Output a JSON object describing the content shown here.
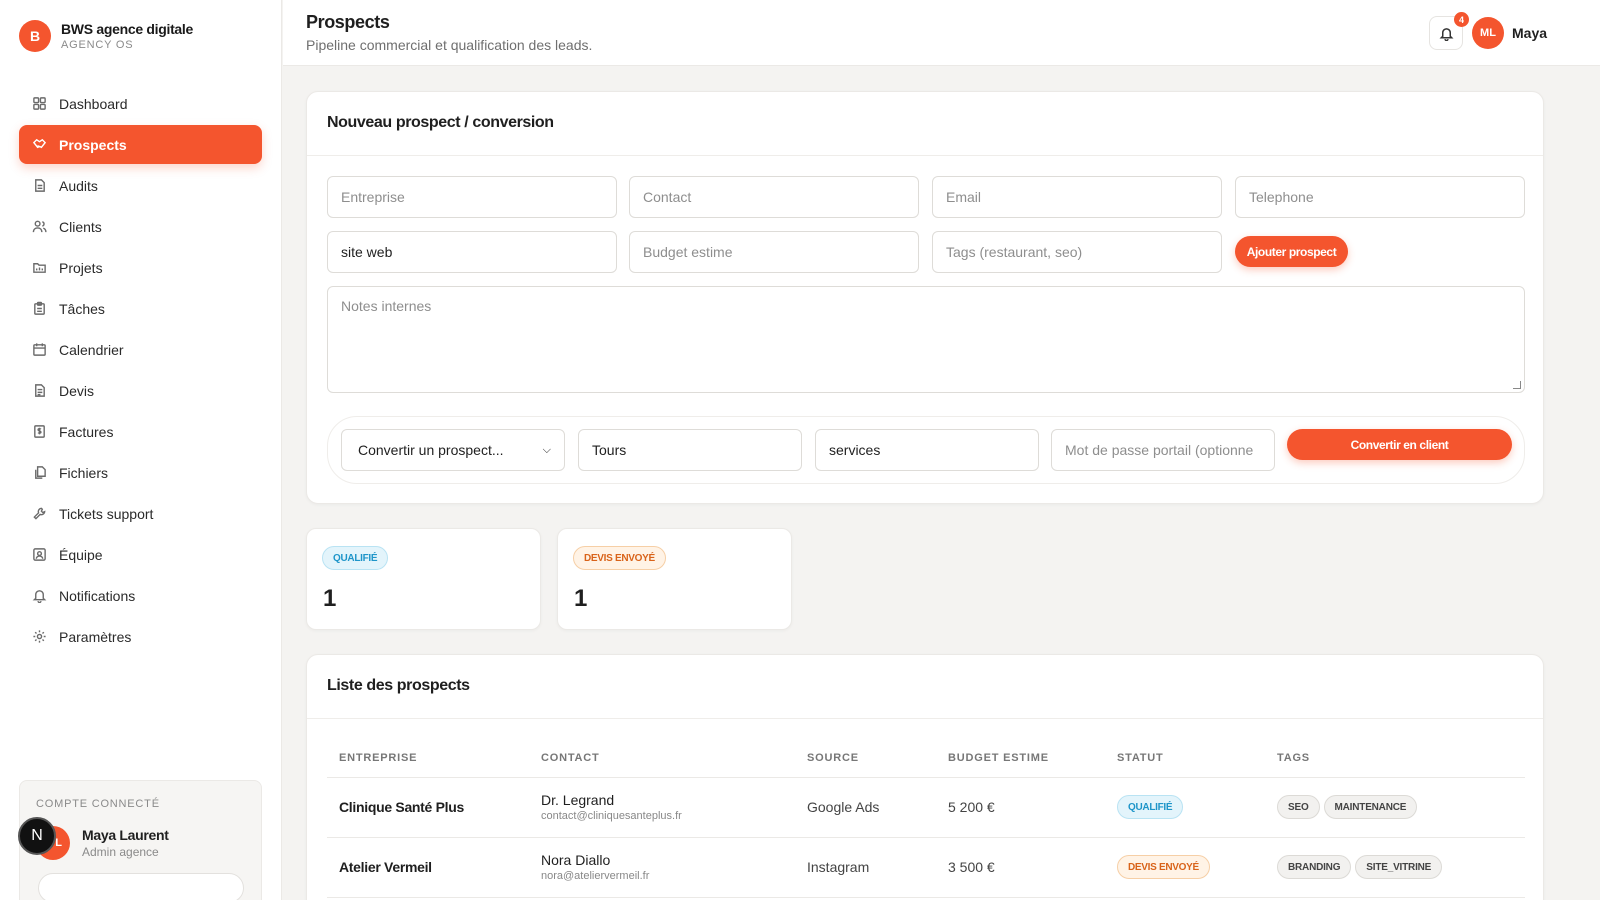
{
  "brand": {
    "logo_letter": "B",
    "name": "BWS agence digitale",
    "subtitle": "AGENCY OS"
  },
  "nav": [
    {
      "label": "Dashboard",
      "icon": "grid-icon",
      "active": false
    },
    {
      "label": "Prospects",
      "icon": "handshake-icon",
      "active": true
    },
    {
      "label": "Audits",
      "icon": "document-icon",
      "active": false
    },
    {
      "label": "Clients",
      "icon": "users-icon",
      "active": false
    },
    {
      "label": "Projets",
      "icon": "folder-icon",
      "active": false
    },
    {
      "label": "Tâches",
      "icon": "clipboard-icon",
      "active": false
    },
    {
      "label": "Calendrier",
      "icon": "calendar-icon",
      "active": false
    },
    {
      "label": "Devis",
      "icon": "file-text-icon",
      "active": false
    },
    {
      "label": "Factures",
      "icon": "receipt-icon",
      "active": false
    },
    {
      "label": "Fichiers",
      "icon": "files-icon",
      "active": false
    },
    {
      "label": "Tickets support",
      "icon": "wrench-icon",
      "active": false
    },
    {
      "label": "Équipe",
      "icon": "id-card-icon",
      "active": false
    },
    {
      "label": "Notifications",
      "icon": "bell-icon",
      "active": false
    },
    {
      "label": "Paramètres",
      "icon": "gear-icon",
      "active": false
    }
  ],
  "account": {
    "title": "COMPTE CONNECTÉ",
    "badge": "N",
    "initials": "L",
    "name": "Maya Laurent",
    "role": "Admin agence"
  },
  "header": {
    "title": "Prospects",
    "subtitle": "Pipeline commercial et qualification des leads.",
    "notif_count": "4",
    "user_initials": "ML",
    "user_name": "Maya"
  },
  "form": {
    "title": "Nouveau prospect / conversion",
    "entreprise_ph": "Entreprise",
    "contact_ph": "Contact",
    "email_ph": "Email",
    "telephone_ph": "Telephone",
    "source_value": "site web",
    "budget_ph": "Budget estime",
    "tags_ph": "Tags (restaurant, seo)",
    "add_button": "Ajouter prospect",
    "notes_ph": "Notes internes",
    "convert_select": "Convertir un prospect...",
    "city_value": "Tours",
    "sector_value": "services",
    "password_ph": "Mot de passe portail (optionne",
    "convert_button": "Convertir en client"
  },
  "stats": [
    {
      "label": "QUALIFIÉ",
      "value": "1",
      "color": "blue"
    },
    {
      "label": "DEVIS ENVOYÉ",
      "value": "1",
      "color": "orange"
    }
  ],
  "list": {
    "title": "Liste des prospects",
    "columns": [
      "ENTREPRISE",
      "CONTACT",
      "SOURCE",
      "BUDGET ESTIME",
      "STATUT",
      "TAGS"
    ],
    "rows": [
      {
        "company": "Clinique Santé Plus",
        "contact_name": "Dr. Legrand",
        "contact_email": "contact@cliniquesanteplus.fr",
        "source": "Google Ads",
        "budget": "5 200 €",
        "status": "QUALIFIÉ",
        "tag1": "SEO",
        "tag2": "MAINTENANCE"
      },
      {
        "company": "Atelier Vermeil",
        "contact_name": "Nora Diallo",
        "contact_email": "nora@ateliervermeil.fr",
        "source": "Instagram",
        "budget": "3 500 €",
        "status": "DEVIS ENVOYÉ",
        "tag1": "BRANDING",
        "tag2": "SITE_VITRINE"
      }
    ]
  },
  "colors": {
    "accent": "#f4552e",
    "qualified": "#1e95c9",
    "quote_sent": "#d9631a"
  }
}
